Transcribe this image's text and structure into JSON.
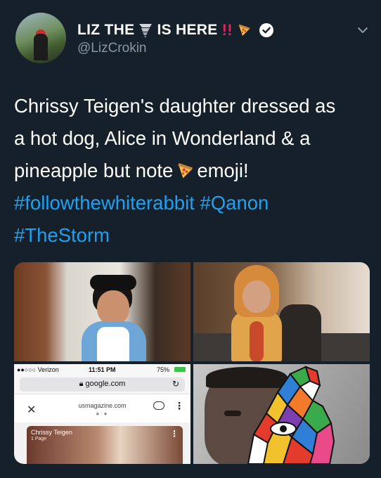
{
  "tweet": {
    "display_name_part1": "LIZ THE",
    "display_name_part2": "IS HERE",
    "bang": "!!",
    "handle": "@LizCrokin",
    "text_lines": [
      "Chrissy Teigen's daughter dressed as",
      "a hot dog, Alice in Wonderland & a",
      "pineapple but note",
      "emoji!"
    ],
    "hashtags": [
      "#followthewhiterabbit",
      "#Qanon",
      "#TheStorm"
    ],
    "icons": {
      "tornado": "tornado-icon",
      "pizza": "pizza-icon",
      "verified": "verified-badge-icon",
      "menu": "chevron-down-icon"
    },
    "colors": {
      "background": "#15202b",
      "hashtag": "#1da1f2",
      "handle": "#8899a6"
    }
  },
  "phone_screenshot": {
    "carrier": "●●○○○ Verizon",
    "time": "11:51 PM",
    "battery": "75%",
    "address": "google.com",
    "site": "usmagazine.com",
    "story_title": "Chrissy Teigen",
    "story_sub": "1 Page"
  }
}
